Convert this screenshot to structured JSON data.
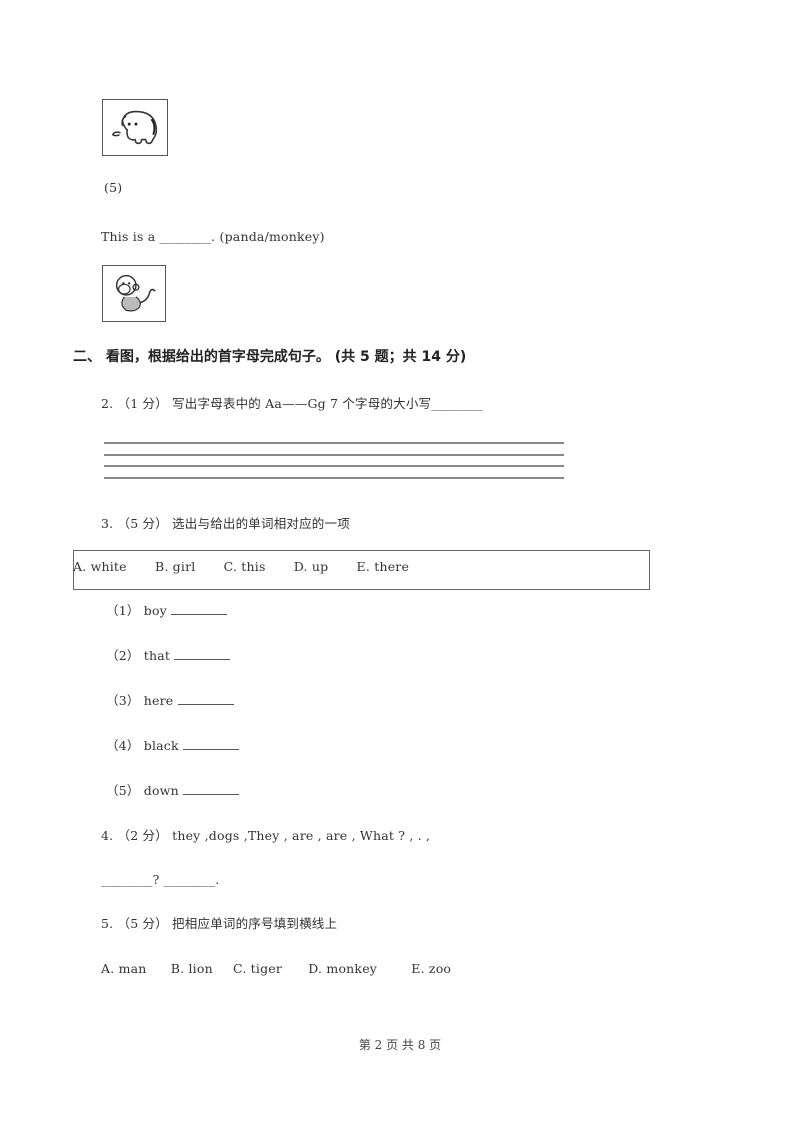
{
  "part1_tail": {
    "elephant_image": "elephant-picture",
    "item5_label": "(5)",
    "item5_sentence": "This is a ________. (panda/monkey)",
    "monkey_image": "monkey-picture"
  },
  "section2": {
    "heading": "二、  看图，根据给出的首字母完成句子。 (共 5 题；共 14 分)"
  },
  "q2": {
    "text": "2. （1 分） 写出字母表中的 Aa——Gg 7 个字母的大小写________"
  },
  "q3": {
    "text": "3. （5 分） 选出与给出的单词相对应的一项",
    "options": [
      "A. white",
      "B. girl",
      "C. this",
      "D. up",
      "E. there"
    ],
    "items": [
      {
        "label": "（1）",
        "word": "boy"
      },
      {
        "label": "（2）",
        "word": "that"
      },
      {
        "label": "（3）",
        "word": "here"
      },
      {
        "label": "（4）",
        "word": "black"
      },
      {
        "label": "（5）",
        "word": "down"
      }
    ]
  },
  "q4": {
    "text": "4. （2 分） they ,dogs ,They , are , are , What ? , . ,",
    "answer_line": "________? ________."
  },
  "q5": {
    "text": "5. （5 分） 把相应单词的序号填到横线上",
    "options": [
      "A. man",
      "B. lion",
      "C. tiger",
      "D. monkey",
      "E. zoo"
    ]
  },
  "footer": {
    "page_text": "第 2 页 共 8 页"
  }
}
